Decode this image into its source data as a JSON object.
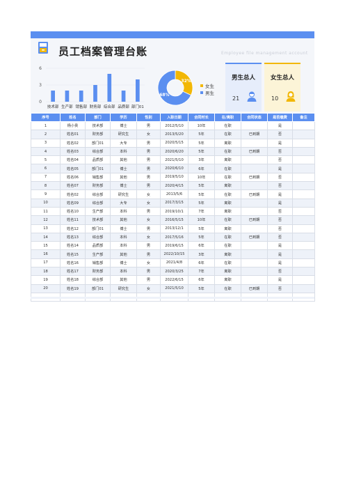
{
  "header": {
    "title": "员工档案管理台账",
    "subtitle": "Employee file management account"
  },
  "cards": {
    "male": {
      "title": "男生总人",
      "value": "21"
    },
    "female": {
      "title": "女生总人",
      "value": "10"
    }
  },
  "colors": {
    "accent": "#5b8ff0",
    "female": "#f2b705",
    "required": "#e5484d"
  },
  "chart_data": [
    {
      "type": "bar",
      "categories": [
        "技术部",
        "生产部",
        "销售部",
        "财务部",
        "综合部",
        "品质部",
        "部门01"
      ],
      "values": [
        2,
        2,
        2,
        3,
        5,
        2,
        4
      ],
      "ylim": [
        0,
        6
      ],
      "yticks": [
        "0",
        "3",
        "6"
      ],
      "grid": true
    },
    {
      "type": "pie",
      "labels": [
        "女生",
        "男生"
      ],
      "values": [
        32,
        68
      ],
      "data_labels": [
        "32%",
        "68%"
      ],
      "legend": "right",
      "colors": [
        "#f2b705",
        "#5b8ff0"
      ]
    }
  ],
  "table": {
    "headers": [
      "序号",
      "姓名",
      "部门",
      "学历",
      "性别",
      "入职日期",
      "合同时长",
      "在/离职",
      "合同状态",
      "是否缴费",
      "备注"
    ],
    "rows": [
      [
        "1",
        "杨小贵",
        "技术部",
        "博士",
        "男",
        "2012/5/10",
        "10年",
        "在职",
        "",
        "是",
        ""
      ],
      [
        "2",
        "姓名01",
        "财务部",
        "研究生",
        "女",
        "2013/5/20",
        "5年",
        "在职",
        "已到期",
        "否",
        ""
      ],
      [
        "3",
        "姓名02",
        "部门01",
        "大专",
        "男",
        "2020/5/15",
        "5年",
        "离职",
        "",
        "是",
        ""
      ],
      [
        "4",
        "姓名03",
        "综合部",
        "本科",
        "男",
        "2020/6/20",
        "5年",
        "在职",
        "已到期",
        "否",
        ""
      ],
      [
        "5",
        "姓名04",
        "品质部",
        "其他",
        "男",
        "2021/5/10",
        "3年",
        "离职",
        "",
        "否",
        ""
      ],
      [
        "6",
        "姓名05",
        "部门01",
        "博士",
        "男",
        "2020/6/10",
        "6年",
        "在职",
        "",
        "是",
        ""
      ],
      [
        "7",
        "姓名06",
        "销售部",
        "其他",
        "男",
        "2019/5/10",
        "10年",
        "在职",
        "已到期",
        "否",
        ""
      ],
      [
        "8",
        "姓名07",
        "财务部",
        "博士",
        "男",
        "2020/4/15",
        "5年",
        "离职",
        "",
        "否",
        ""
      ],
      [
        "9",
        "姓名02",
        "综合部",
        "研究生",
        "女",
        "2013/5/6",
        "5年",
        "在职",
        "已到期",
        "是",
        ""
      ],
      [
        "10",
        "姓名09",
        "综合部",
        "大专",
        "女",
        "2017/3/15",
        "5年",
        "离职",
        "",
        "是",
        ""
      ],
      [
        "11",
        "姓名10",
        "生产部",
        "本科",
        "男",
        "2019/10/1",
        "7年",
        "离职",
        "",
        "否",
        ""
      ],
      [
        "12",
        "姓名11",
        "技术部",
        "其他",
        "女",
        "2016/5/15",
        "10年",
        "在职",
        "已到期",
        "否",
        ""
      ],
      [
        "13",
        "姓名12",
        "部门01",
        "博士",
        "男",
        "2013/12/1",
        "5年",
        "离职",
        "",
        "否",
        ""
      ],
      [
        "14",
        "姓名13",
        "综合部",
        "本科",
        "女",
        "2017/5/16",
        "5年",
        "在职",
        "已到期",
        "否",
        ""
      ],
      [
        "15",
        "姓名14",
        "品质部",
        "本科",
        "男",
        "2019/6/15",
        "6年",
        "在职",
        "",
        "是",
        ""
      ],
      [
        "16",
        "姓名15",
        "生产部",
        "其他",
        "男",
        "2022/10/15",
        "3年",
        "离职",
        "",
        "是",
        ""
      ],
      [
        "17",
        "姓名16",
        "销售部",
        "博士",
        "女",
        "2021/4/8",
        "6年",
        "在职",
        "",
        "是",
        ""
      ],
      [
        "18",
        "姓名17",
        "财务部",
        "本科",
        "男",
        "2020/3/25",
        "7年",
        "离职",
        "",
        "否",
        ""
      ],
      [
        "19",
        "姓名18",
        "综合部",
        "其他",
        "男",
        "2022/6/15",
        "6年",
        "离职",
        "",
        "是",
        ""
      ],
      [
        "20",
        "姓名19",
        "部门01",
        "研究生",
        "女",
        "2021/5/10",
        "5年",
        "在职",
        "已到期",
        "否",
        ""
      ],
      [
        "-",
        "",
        "",
        "",
        "",
        "",
        "",
        "",
        "",
        "",
        ""
      ]
    ]
  }
}
